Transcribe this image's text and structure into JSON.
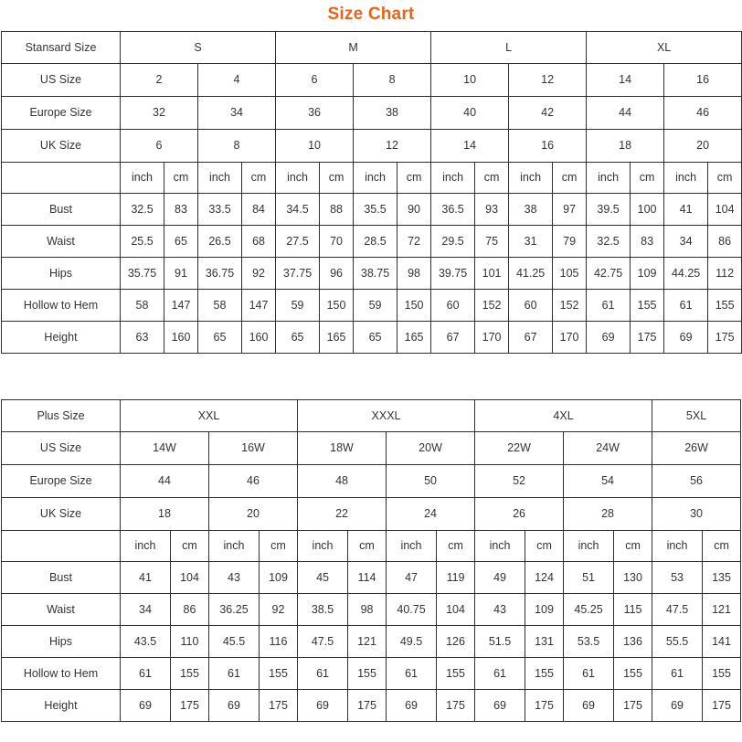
{
  "title": "Size Chart",
  "accent_color": "#e8641c",
  "border_color": "#2f2f2f",
  "tables": [
    {
      "id": "standard-size-table",
      "corner_label": "Stansard Size",
      "groups": [
        {
          "label": "S",
          "span": 2
        },
        {
          "label": "M",
          "span": 2
        },
        {
          "label": "L",
          "span": 2
        },
        {
          "label": "XL",
          "span": 2
        }
      ],
      "size_rows": [
        {
          "label": "US Size",
          "bold": true,
          "values": [
            "2",
            "4",
            "6",
            "8",
            "10",
            "12",
            "14",
            "16"
          ]
        },
        {
          "label": "Europe Size",
          "bold": false,
          "values": [
            "32",
            "34",
            "36",
            "38",
            "40",
            "42",
            "44",
            "46"
          ]
        },
        {
          "label": "UK Size",
          "bold": false,
          "values": [
            "6",
            "8",
            "10",
            "12",
            "14",
            "16",
            "18",
            "20"
          ]
        }
      ],
      "unit_row": {
        "label": "",
        "units": [
          "inch",
          "cm",
          "inch",
          "cm",
          "inch",
          "cm",
          "inch",
          "cm",
          "inch",
          "cm",
          "inch",
          "cm",
          "inch",
          "cm",
          "inch",
          "cm"
        ]
      },
      "measure_rows": [
        {
          "label": "Bust",
          "values": [
            "32.5",
            "83",
            "33.5",
            "84",
            "34.5",
            "88",
            "35.5",
            "90",
            "36.5",
            "93",
            "38",
            "97",
            "39.5",
            "100",
            "41",
            "104"
          ]
        },
        {
          "label": "Waist",
          "values": [
            "25.5",
            "65",
            "26.5",
            "68",
            "27.5",
            "70",
            "28.5",
            "72",
            "29.5",
            "75",
            "31",
            "79",
            "32.5",
            "83",
            "34",
            "86"
          ]
        },
        {
          "label": "Hips",
          "values": [
            "35.75",
            "91",
            "36.75",
            "92",
            "37.75",
            "96",
            "38.75",
            "98",
            "39.75",
            "101",
            "41.25",
            "105",
            "42.75",
            "109",
            "44.25",
            "112"
          ]
        },
        {
          "label": "Hollow to Hem",
          "values": [
            "58",
            "147",
            "58",
            "147",
            "59",
            "150",
            "59",
            "150",
            "60",
            "152",
            "60",
            "152",
            "61",
            "155",
            "61",
            "155"
          ]
        },
        {
          "label": "Height",
          "values": [
            "63",
            "160",
            "65",
            "160",
            "65",
            "165",
            "65",
            "165",
            "67",
            "170",
            "67",
            "170",
            "69",
            "175",
            "69",
            "175"
          ]
        }
      ]
    },
    {
      "id": "plus-size-table",
      "corner_label": "Plus Size",
      "groups": [
        {
          "label": "XXL",
          "span": 2
        },
        {
          "label": "XXXL",
          "span": 2
        },
        {
          "label": "4XL",
          "span": 2
        },
        {
          "label": "5XL",
          "span": 1
        }
      ],
      "size_rows": [
        {
          "label": "US Size",
          "bold": true,
          "values": [
            "14W",
            "16W",
            "18W",
            "20W",
            "22W",
            "24W",
            "26W"
          ]
        },
        {
          "label": "Europe Size",
          "bold": false,
          "values": [
            "44",
            "46",
            "48",
            "50",
            "52",
            "54",
            "56"
          ]
        },
        {
          "label": "UK Size",
          "bold": false,
          "values": [
            "18",
            "20",
            "22",
            "24",
            "26",
            "28",
            "30"
          ]
        }
      ],
      "unit_row": {
        "label": "",
        "units": [
          "inch",
          "cm",
          "inch",
          "cm",
          "inch",
          "cm",
          "inch",
          "cm",
          "inch",
          "cm",
          "inch",
          "cm",
          "inch",
          "cm"
        ]
      },
      "measure_rows": [
        {
          "label": "Bust",
          "values": [
            "41",
            "104",
            "43",
            "109",
            "45",
            "114",
            "47",
            "119",
            "49",
            "124",
            "51",
            "130",
            "53",
            "135"
          ]
        },
        {
          "label": "Waist",
          "values": [
            "34",
            "86",
            "36.25",
            "92",
            "38.5",
            "98",
            "40.75",
            "104",
            "43",
            "109",
            "45.25",
            "115",
            "47.5",
            "121"
          ]
        },
        {
          "label": "Hips",
          "values": [
            "43.5",
            "110",
            "45.5",
            "116",
            "47.5",
            "121",
            "49.5",
            "126",
            "51.5",
            "131",
            "53.5",
            "136",
            "55.5",
            "141"
          ]
        },
        {
          "label": "Hollow to Hem",
          "values": [
            "61",
            "155",
            "61",
            "155",
            "61",
            "155",
            "61",
            "155",
            "61",
            "155",
            "61",
            "155",
            "61",
            "155"
          ]
        },
        {
          "label": "Height",
          "values": [
            "69",
            "175",
            "69",
            "175",
            "69",
            "175",
            "69",
            "175",
            "69",
            "175",
            "69",
            "175",
            "69",
            "175"
          ]
        }
      ]
    }
  ]
}
